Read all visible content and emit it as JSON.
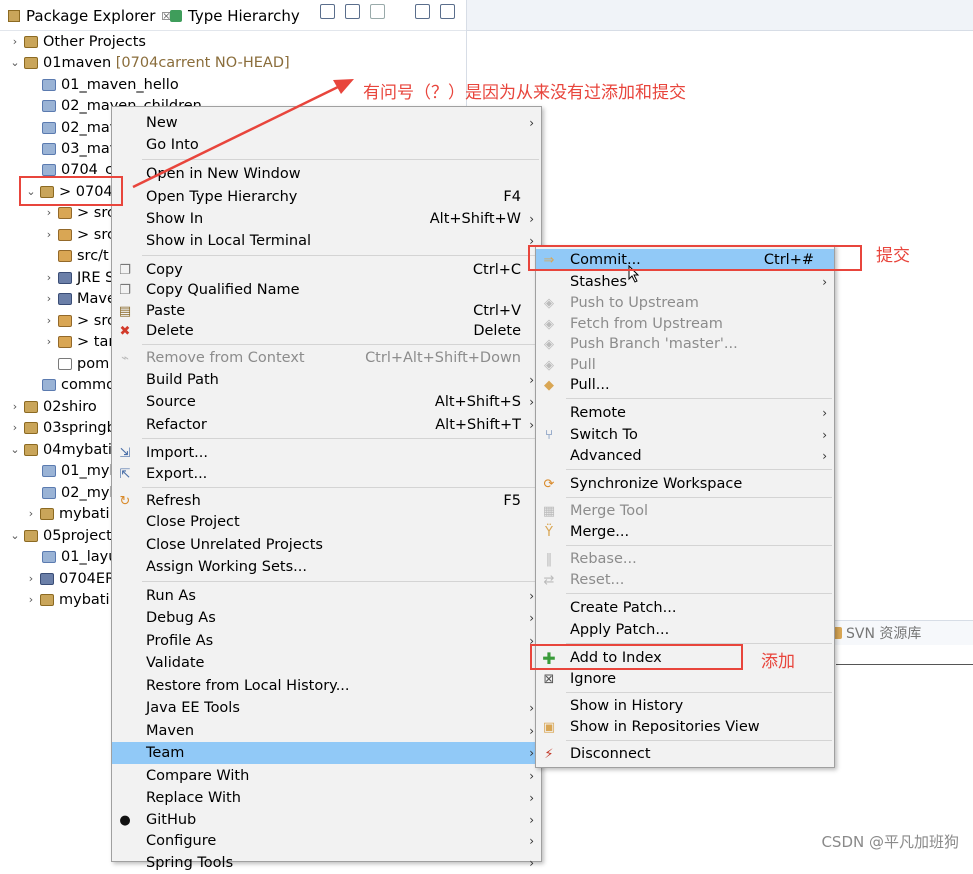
{
  "tabs": {
    "package_explorer": "Package Explorer",
    "close_mark": "☒",
    "type_hierarchy": "Type Hierarchy"
  },
  "tree": {
    "other_projects": "Other Projects",
    "p01": "01maven",
    "p01_deco": "[0704carrent NO-HEAD]",
    "m01": "01_maven_hello",
    "m02": "02_maven_children",
    "m03": "02_mav",
    "m04": "03_mav",
    "m05": "0704_c",
    "m06": "> 0704",
    "c1": "> src",
    "c2": "> src",
    "c3": "src/t",
    "c4": "JRE S",
    "c5": "Mave",
    "c6": "> src",
    "c7": "> tar",
    "c8": "pom",
    "m07": "commo",
    "p02": "02shiro",
    "p03": "03springb",
    "p04": "04mybatis",
    "p04a": "01_myb",
    "p04b": "02_myb",
    "p04c": "mybati",
    "p05": "05project",
    "p05a": "01_layu",
    "p05b": "0704ER",
    "p05c": "mybati"
  },
  "context_menu": {
    "new": "New",
    "go_into": "Go Into",
    "open_new_window": "Open in New Window",
    "open_type_hierarchy": "Open Type Hierarchy",
    "open_type_hierarchy_sc": "F4",
    "show_in": "Show In",
    "show_in_sc": "Alt+Shift+W",
    "show_local_terminal": "Show in Local Terminal",
    "copy": "Copy",
    "copy_sc": "Ctrl+C",
    "copy_qualified": "Copy Qualified Name",
    "paste": "Paste",
    "paste_sc": "Ctrl+V",
    "delete": "Delete",
    "delete_sc": "Delete",
    "remove_context": "Remove from Context",
    "remove_context_sc": "Ctrl+Alt+Shift+Down",
    "build_path": "Build Path",
    "source": "Source",
    "source_sc": "Alt+Shift+S",
    "refactor": "Refactor",
    "refactor_sc": "Alt+Shift+T",
    "import": "Import...",
    "export": "Export...",
    "refresh": "Refresh",
    "refresh_sc": "F5",
    "close_project": "Close Project",
    "close_unrelated": "Close Unrelated Projects",
    "assign_sets": "Assign Working Sets...",
    "run_as": "Run As",
    "debug_as": "Debug As",
    "profile_as": "Profile As",
    "validate": "Validate",
    "restore_history": "Restore from Local History...",
    "java_ee_tools": "Java EE Tools",
    "maven": "Maven",
    "team": "Team",
    "compare_with": "Compare With",
    "replace_with": "Replace With",
    "github": "GitHub",
    "configure": "Configure",
    "spring_tools": "Spring Tools"
  },
  "team_menu": {
    "commit": "Commit...",
    "commit_sc": "Ctrl+#",
    "stashes": "Stashes",
    "push_upstream": "Push to Upstream",
    "fetch_upstream": "Fetch from Upstream",
    "push_branch": "Push Branch 'master'...",
    "pull": "Pull",
    "pull_dots": "Pull...",
    "remote": "Remote",
    "switch_to": "Switch To",
    "advanced": "Advanced",
    "sync_workspace": "Synchronize Workspace",
    "merge_tool": "Merge Tool",
    "merge": "Merge...",
    "rebase": "Rebase...",
    "reset": "Reset...",
    "create_patch": "Create Patch...",
    "apply_patch": "Apply Patch...",
    "add_to_index": "Add to Index",
    "ignore": "Ignore",
    "show_history": "Show in History",
    "show_repos": "Show in Repositories View",
    "disconnect": "Disconnect"
  },
  "annotations": {
    "question_note": "有问号（？）是因为从来没有过添加和提交",
    "commit_note": "提交",
    "add_note": "添加"
  },
  "svn_tab": "SVN 资源库",
  "watermark": "CSDN @平凡加班狗",
  "colors": {
    "highlight": "#91c9f7",
    "annotation_red": "#e8453c",
    "menu_bg": "#f2f2f2"
  }
}
